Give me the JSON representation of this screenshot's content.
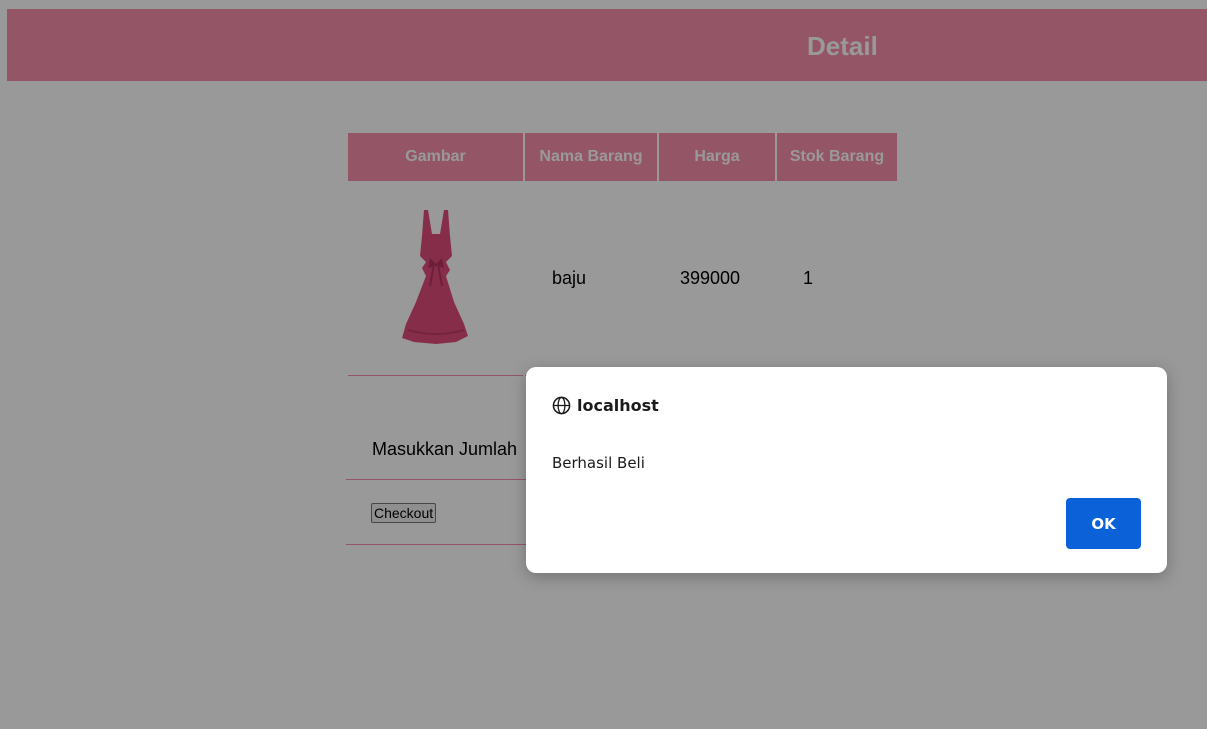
{
  "header": {
    "title": "Detail"
  },
  "table": {
    "headers": [
      "Gambar",
      "Nama Barang",
      "Harga",
      "Stok Barang"
    ],
    "rows": [
      {
        "image_icon": "pink-dress-image",
        "name": "baju",
        "price": "399000",
        "stock": "1"
      }
    ]
  },
  "form": {
    "quantity_label": "Masukkan Jumlah",
    "checkout_label": "Checkout"
  },
  "dialog": {
    "origin": "localhost",
    "message": "Berhasil Beli",
    "ok_label": "OK",
    "icon": "globe-icon"
  },
  "colors": {
    "accent": "#f78fab",
    "primary_button": "#0b62d8",
    "overlay": "rgba(0,0,0,0.4)"
  }
}
